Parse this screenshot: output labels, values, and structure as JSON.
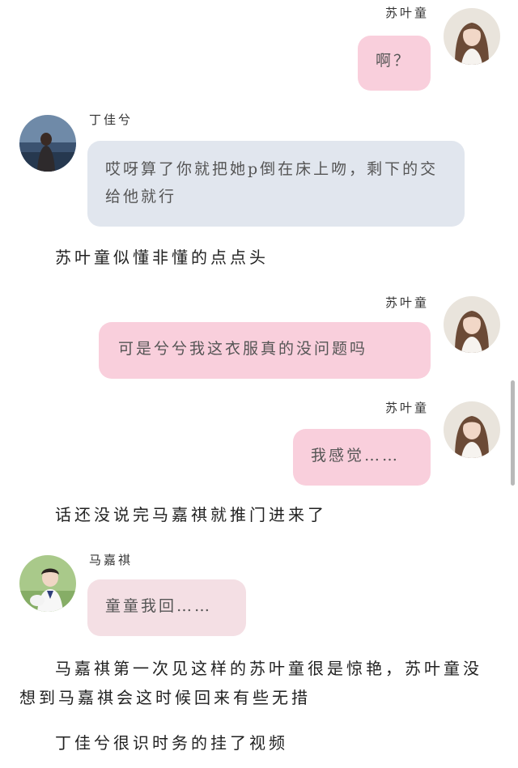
{
  "messages": [
    {
      "sender": "苏叶童",
      "text": "啊？"
    },
    {
      "sender": "丁佳兮",
      "text": "哎呀算了你就把她p倒在床上吻，剩下的交给他就行"
    },
    {
      "sender": "苏叶童",
      "text": "可是兮兮我这衣服真的没问题吗"
    },
    {
      "sender": "苏叶童",
      "text": "我感觉……"
    },
    {
      "sender": "马嘉祺",
      "text": "童童我回……"
    }
  ],
  "narration": [
    "苏叶童似懂非懂的点点头",
    "话还没说完马嘉祺就推门进来了",
    "马嘉祺第一次见这样的苏叶童很是惊艳，苏叶童没想到马嘉祺会这时候回来有些无措",
    "丁佳兮很识时务的挂了视频"
  ],
  "colors": {
    "pink_bubble": "#f9cfdc",
    "blue_bubble": "#e1e6ee",
    "rose_bubble": "#f4dfe4"
  }
}
